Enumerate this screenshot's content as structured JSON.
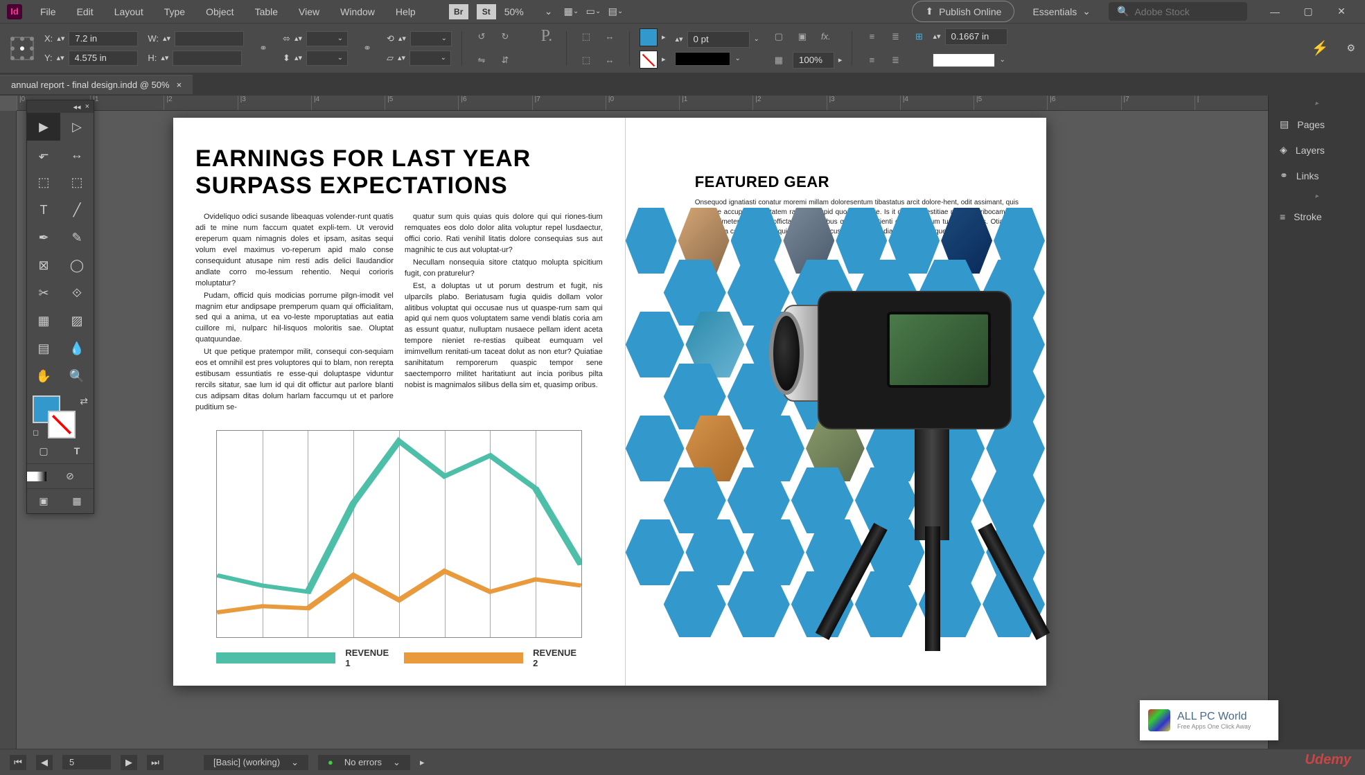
{
  "app_id": "Id",
  "menu": [
    "File",
    "Edit",
    "Layout",
    "Type",
    "Object",
    "Table",
    "View",
    "Window",
    "Help"
  ],
  "bridge_btn": "Br",
  "stock_btn": "St",
  "zoom": "50%",
  "publish": "Publish Online",
  "workspace": "Essentials",
  "search_placeholder": "Adobe Stock",
  "control": {
    "x_label": "X:",
    "x_val": "7.2 in",
    "y_label": "Y:",
    "y_val": "4.575 in",
    "w_label": "W:",
    "h_label": "H:",
    "pt": "0 pt",
    "pct": "100%",
    "inch": "0.1667 in"
  },
  "doc_tab": "annual report - final design.indd @ 50%",
  "ruler_marks": [
    "|0",
    "|1",
    "|2",
    "|3",
    "|4",
    "|5",
    "|6",
    "|7",
    "|0",
    "|1",
    "|2",
    "|3",
    "|4",
    "|5",
    "|6",
    "|7",
    "|"
  ],
  "left_page": {
    "headline_1": "EARNINGS FOR LAST YEAR",
    "headline_2": "SURPASS EXPECTATIONS",
    "col1_p1": "Ovideliquo odici susande libeaquas volender-runt quatis adi te mine num faccum quatet expli-tem. Ut verovid ereperum quam nimagnis doles et ipsam, asitas sequi volum evel maximus vo-reperum apid malo conse consequidunt atusape nim resti adis delici llaudandior andlate corro mo-lessum rehentio. Nequi corioris moluptatur?",
    "col1_p2": "Pudam, officid quis modicias porrume pilgn-imodit vel magnim etur andipsape premperum quam qui officialitam, sed qui a anima, ut ea vo-leste mporuptatias aut eatia cuillore mi, nulparc hil-lisquos moloritis sae. Oluptat quatquundae.",
    "col1_p3": "Ut que petique pratempor milit, consequi con-sequiam eos et omnihil est pres voluptores qui to blam, non rerepta estibusam essuntiatis re esse-qui doluptaspe viduntur rercils sitatur, sae lum id qui dit offictur aut parlore blanti cus adipsam ditas dolum harlam faccumqu ut et parlore puditium se-",
    "col2_p1": "quatur sum quis quias quis dolore qui qui riones-tium remquates eos dolo dolor alita voluptur repel lusdaectur, offici corio. Rati venihil litatis dolore consequias sus aut magnihic te cus aut voluptat-ur?",
    "col2_p2": "Necullam nonsequia sitore ctatquo molupta spicitium fugit, con praturelur?",
    "col2_p3": "Est, a doluptas ut ut porum destrum et fugit, nis ulparcils plabo. Beriatusam fugia quidis dollam volor alitibus voluptat qui occusae nus ut quaspe-rum sam qui apid qui nem quos voluptatem same vendi blatis coria am as essunt quatur, nulluptam nusaece pellam ident aceta tempore nieniet re-restias quibeat eumquam vel imimvellum renitati-um taceat dolut as non etur? Quiatiae sanihitatum remporerum quaspic tempor sene saectemporro militet haritatiunt aut incia poribus pilta nobist is magnimalos silibus della sim et, quasimp oribus."
  },
  "right_page": {
    "title": "FEATURED GEAR",
    "body": "Onsequod ignatiasti conatur moremi millam doloresentum tibastatus arcit dolore-hent, odit assimant, quis seruhine accupta qui optatem rasant volupid quo eic dolore. Is it doloptas estitiae nos un reribocame, id que minimetem, quomte officta qui doloptibus quam, aut etienti officitas vetum turis nobilates. Otiae vel lab in hi pa ca onoc-que eaquide cipsam faccust omnihilit quodia que prat plia que lamet"
  },
  "chart_data": {
    "type": "line",
    "x": [
      0,
      1,
      2,
      3,
      4,
      5,
      6,
      7,
      8
    ],
    "series": [
      {
        "name": "REVENUE 1",
        "color": "#4dbfa8",
        "values": [
          30,
          25,
          22,
          65,
          95,
          78,
          88,
          72,
          35
        ]
      },
      {
        "name": "REVENUE 2",
        "color": "#e89a3c",
        "values": [
          12,
          15,
          14,
          30,
          18,
          32,
          22,
          28,
          25
        ]
      }
    ],
    "ylim": [
      0,
      100
    ],
    "xlim": [
      0,
      8
    ]
  },
  "panels": [
    "Pages",
    "Layers",
    "Links",
    "Stroke"
  ],
  "status": {
    "page": "5",
    "preset": "[Basic] (working)",
    "errors": "No errors"
  },
  "watermark": {
    "brand": "ALL PC World",
    "tag": "Free Apps One Click Away",
    "udemy": "Udemy"
  }
}
